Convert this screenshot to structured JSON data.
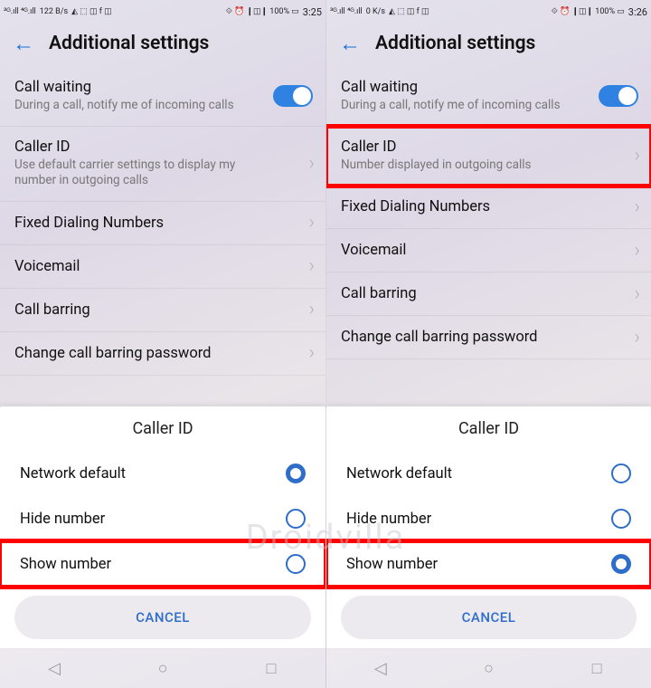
{
  "watermark": "Droidvilla",
  "left": {
    "status": {
      "net_left": "³ᴳ.ıll ⁴ᴳ.ıll",
      "speed": "122 B/s",
      "icons_left": "◭ ⬚ ◫ f ◫",
      "icons_right": "⟐ ⏰ ❙◫❙ 100%  ▭",
      "time": "3:25"
    },
    "header": {
      "title": "Additional settings"
    },
    "rows": {
      "call_waiting": {
        "label": "Call waiting",
        "sub": "During a call, notify me of incoming calls"
      },
      "caller_id": {
        "label": "Caller ID",
        "sub": "Use default carrier settings to display my number in outgoing calls"
      },
      "fixed": {
        "label": "Fixed Dialing Numbers"
      },
      "voicemail": {
        "label": "Voicemail"
      },
      "barring": {
        "label": "Call barring"
      },
      "change_pw": {
        "label": "Change call barring password"
      }
    },
    "sheet": {
      "title": "Caller ID",
      "options": {
        "network_default": "Network default",
        "hide": "Hide number",
        "show": "Show number"
      },
      "selected": "network_default",
      "highlighted": "show",
      "cancel": "CANCEL"
    }
  },
  "right": {
    "status": {
      "net_left": "³ᴳ.ıll ⁴ᴳ.ıll",
      "speed": "0 K/s",
      "icons_left": "◭ ⬚ ◫ f ◫",
      "icons_right": "⟐ ⏰ ❙◫❙ 100%  ▭",
      "time": "3:26"
    },
    "header": {
      "title": "Additional settings"
    },
    "rows": {
      "call_waiting": {
        "label": "Call waiting",
        "sub": "During a call, notify me of incoming calls"
      },
      "caller_id": {
        "label": "Caller ID",
        "sub": "Number displayed in outgoing calls"
      },
      "fixed": {
        "label": "Fixed Dialing Numbers"
      },
      "voicemail": {
        "label": "Voicemail"
      },
      "barring": {
        "label": "Call barring"
      },
      "change_pw": {
        "label": "Change call barring password"
      }
    },
    "sheet": {
      "title": "Caller ID",
      "options": {
        "network_default": "Network default",
        "hide": "Hide number",
        "show": "Show number"
      },
      "selected": "show",
      "highlighted": "show",
      "cancel": "CANCEL"
    }
  }
}
